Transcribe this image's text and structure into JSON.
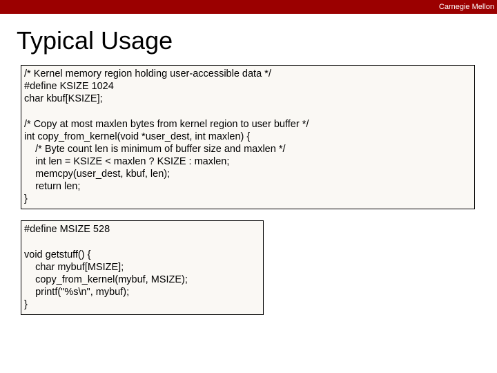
{
  "header": {
    "brand": "Carnegie Mellon"
  },
  "title": "Typical Usage",
  "code1": {
    "l0": "/* Kernel memory region holding user-accessible data */",
    "l1": "#define KSIZE 1024",
    "l2": "char kbuf[KSIZE];",
    "l3": "/* Copy at most maxlen bytes from kernel region to user buffer */",
    "l4": "int copy_from_kernel(void *user_dest, int maxlen) {",
    "l5": "    /* Byte count len is minimum of buffer size and maxlen */",
    "l6": "    int len = KSIZE < maxlen ? KSIZE : maxlen;",
    "l7": "    memcpy(user_dest, kbuf, len);",
    "l8": "    return len;",
    "l9": "}"
  },
  "code2": {
    "l0": "#define MSIZE 528",
    "l1": "void getstuff() {",
    "l2": "    char mybuf[MSIZE];",
    "l3": "    copy_from_kernel(mybuf, MSIZE);",
    "l4": "    printf(\"%s\\n\", mybuf);",
    "l5": "}"
  }
}
